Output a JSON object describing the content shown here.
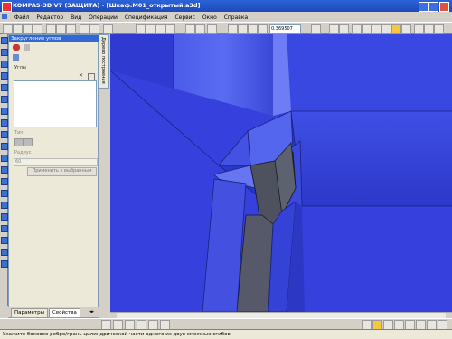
{
  "window": {
    "title": "KOMPAS-3D V7 (ЗАЩИТА) - [Шкаф.M01_открытый.a3d]"
  },
  "menu": [
    "Файл",
    "Редактор",
    "Вид",
    "Операции",
    "Спецификация",
    "Сервис",
    "Окно",
    "Справка"
  ],
  "toolbar": {
    "zoom_value": "0.369507"
  },
  "panel": {
    "title": "Закругление углов",
    "edges_label": "Углы",
    "type_label": "Тип",
    "radius_label": "Радиус",
    "radius_value": "60",
    "apply_button": "Применить к выбранным"
  },
  "side_tab": {
    "label": "Дерево построения"
  },
  "tabs": {
    "params": "Параметры",
    "props": "Свойства"
  },
  "status": {
    "text": "Укажите боковое ребро/грань цилиндрической части одного из двух смежных сгибов"
  }
}
